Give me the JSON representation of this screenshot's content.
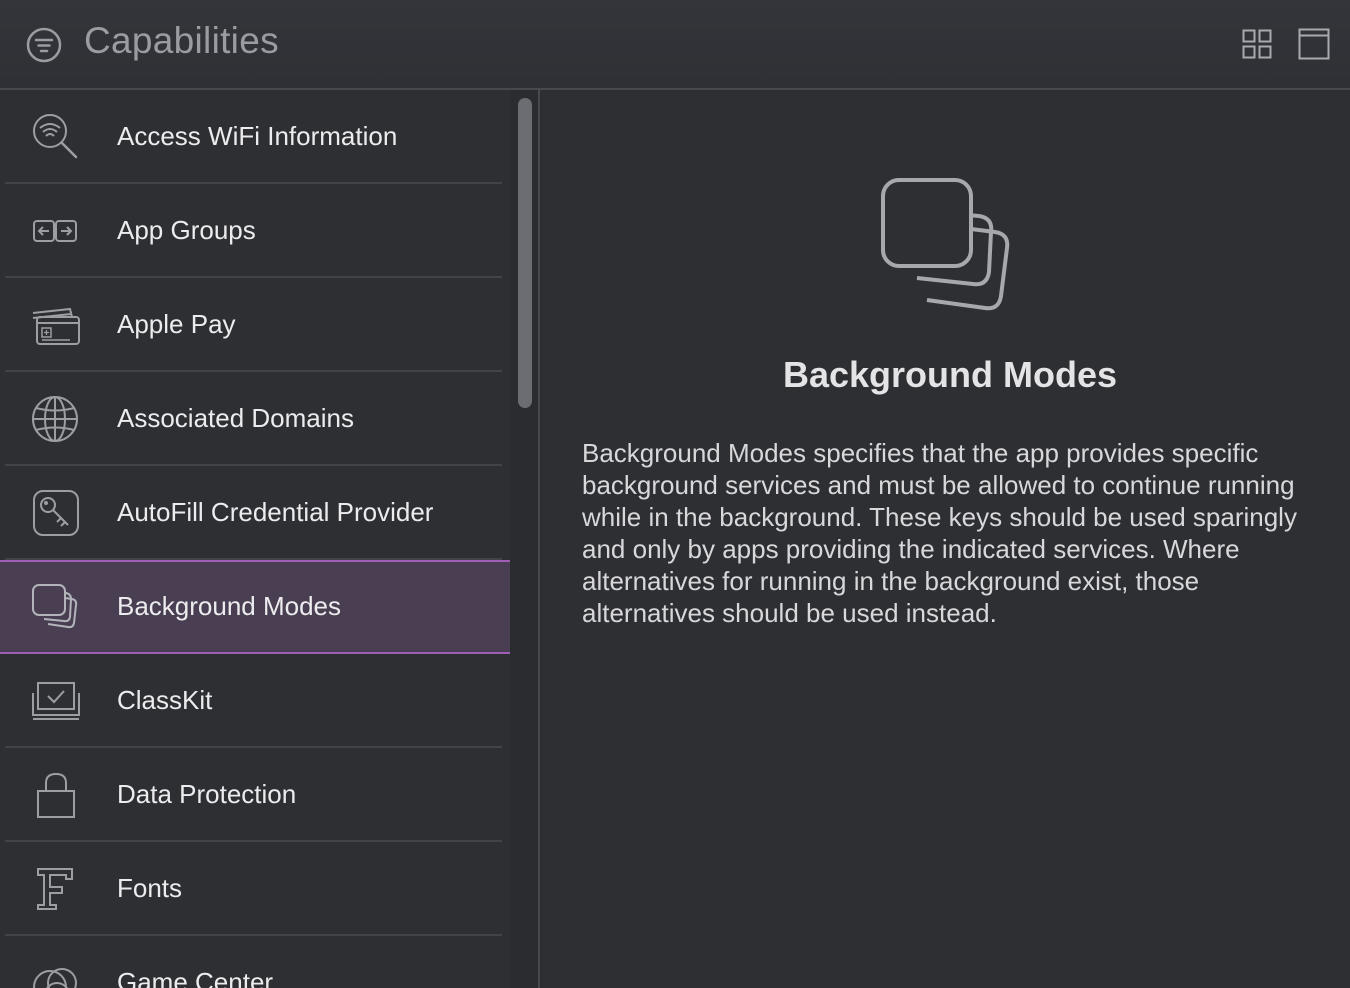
{
  "header": {
    "title": "Capabilities"
  },
  "capabilities": [
    {
      "label": "Access WiFi Information",
      "icon": "wifi-search-icon"
    },
    {
      "label": "App Groups",
      "icon": "app-groups-icon"
    },
    {
      "label": "Apple Pay",
      "icon": "apple-pay-card-icon"
    },
    {
      "label": "Associated Domains",
      "icon": "globe-icon"
    },
    {
      "label": "AutoFill Credential Provider",
      "icon": "key-icon"
    },
    {
      "label": "Background Modes",
      "icon": "stacked-squares-icon",
      "selected": true
    },
    {
      "label": "ClassKit",
      "icon": "classkit-check-icon"
    },
    {
      "label": "Data Protection",
      "icon": "lock-icon"
    },
    {
      "label": "Fonts",
      "icon": "fonts-icon"
    },
    {
      "label": "Game Center",
      "icon": "game-center-icon"
    }
  ],
  "detail": {
    "title": "Background Modes",
    "description": "Background Modes specifies that the app provides specific background services and must be allowed to continue running while in the background. These keys should be used sparingly and only by apps providing the indicated services. Where alternatives for running in the background exist, those alternatives should be used instead."
  },
  "colors": {
    "selection_border": "#a05db5",
    "selection_fill": "#4a3f52"
  }
}
